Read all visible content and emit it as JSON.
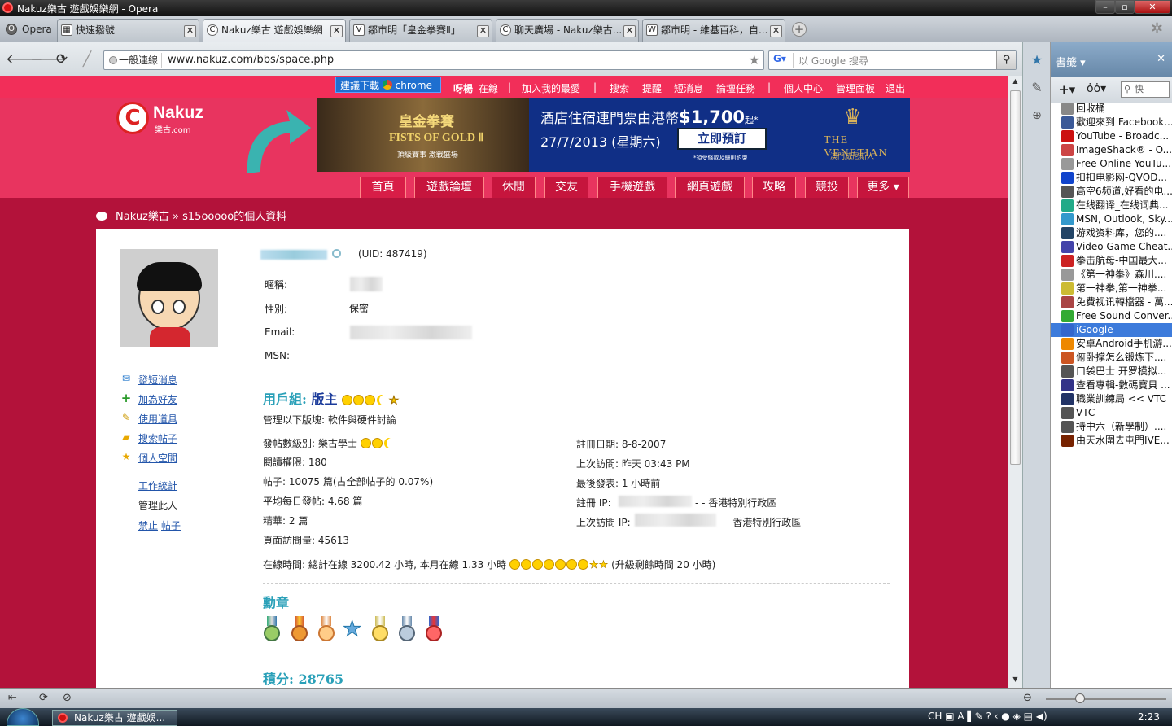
{
  "window": {
    "title": "Nakuz樂古 遊戲娛樂網 - Opera"
  },
  "browser": {
    "opera_label": "Opera",
    "tabs": [
      {
        "label": "快速撥號"
      },
      {
        "label": "Nakuz樂古 遊戲娛樂網"
      },
      {
        "label": "鄒市明「皇金拳賽Ⅱ」"
      },
      {
        "label": "聊天廣場 - Nakuz樂古..."
      },
      {
        "label": "鄒市明 - 維基百科，自..."
      }
    ],
    "security_label": "一般連線",
    "url": "www.nakuz.com/bbs/space.php",
    "search_placeholder": "以 Google 搜尋"
  },
  "site": {
    "download_label": "建議下載",
    "chrome_label": "chrome",
    "greeting_user": "呀楊",
    "online_label": "在線",
    "sep": "|",
    "links": [
      "加入我的最愛",
      "搜索",
      "提醒",
      "短消息",
      "論壇任務",
      "個人中心",
      "管理面板",
      "退出"
    ],
    "logo": {
      "name": "Nakuz",
      "domain": "樂古.com"
    },
    "banner": {
      "gold_title": "皇金拳賽",
      "fists": "FISTS OF GOLD Ⅱ",
      "sub": "頂級賽事 激戰盛場",
      "line1_prefix": "酒店住宿連門票由港幣",
      "price": "$1,700",
      "price_suffix": "起*",
      "date": "27/7/2013 (星期六)",
      "book_label": "立即預訂",
      "tnc": "*須受條款及細則約束",
      "brand": "THE VENETIAN",
      "brand_cn": "澳門威尼斯人"
    },
    "nav": [
      "首頁",
      "遊戲論壇",
      "休閒",
      "交友",
      "手機遊戲",
      "網頁遊戲",
      "攻略",
      "競投",
      "更多 ▾"
    ],
    "breadcrumb": {
      "home": "Nakuz樂古",
      "sep": "»",
      "current": "s15ooooo的個人資料"
    }
  },
  "profile": {
    "uid": "(UID: 487419)",
    "fields": [
      {
        "label": "暱稱:",
        "value": ""
      },
      {
        "label": "性別:",
        "value": "保密"
      },
      {
        "label": "Email:",
        "value": ""
      },
      {
        "label": "MSN:",
        "value": ""
      }
    ],
    "actions": [
      "發短消息",
      "加為好友",
      "使用道具",
      "搜索帖子",
      "個人空間"
    ],
    "admin": {
      "stats": "工作統計",
      "manage": "管理此人",
      "ban": "禁止",
      "posts": "帖子"
    },
    "group_label": "用戶組:",
    "group_value": "版主",
    "manage_forums_label": "管理以下版塊:",
    "manage_forums_value": "軟件與硬件討論",
    "left_stats": [
      "發帖數級別: 樂古學士",
      "閱讀權限: 180",
      "帖子: 10075 篇(占全部帖子的 0.07%)",
      "平均每日發帖: 4.68 篇",
      "精華: 2 篇",
      "頁面訪問量: 45613"
    ],
    "right_stats": [
      "註冊日期: 8-8-2007",
      "上次訪問: 昨天 03:43 PM",
      "最後發表: 1 小時前",
      "註冊 IP:",
      "上次訪問 IP:"
    ],
    "ip_region": "- - 香港特別行政區",
    "online_text": "在線時間: 總計在線 3200.42 小時, 本月在線 1.33 小時",
    "upgrade_text": "(升級剩餘時間 20 小時)",
    "medals_title": "勳章",
    "points_label": "積分:",
    "points_value": "28765"
  },
  "bookmarks": {
    "title": "書籤 ▾",
    "search_ph": "快",
    "items": [
      {
        "label": "回收桶",
        "icon": "trash-icon",
        "color": "#888"
      },
      {
        "label": "歡迎來到 Facebook...",
        "icon": "facebook-icon",
        "color": "#3b5998"
      },
      {
        "label": "YouTube - Broadc...",
        "icon": "youtube-icon",
        "color": "#cc1111"
      },
      {
        "label": "ImageShack® - O...",
        "icon": "imageshack-icon",
        "color": "#c44"
      },
      {
        "label": "Free Online YouTu...",
        "icon": "grid-icon",
        "color": "#999"
      },
      {
        "label": "扣扣电影网-QVOD...",
        "icon": "qvod-icon",
        "color": "#1144cc"
      },
      {
        "label": "高空6频道,好看的电...",
        "icon": "star-icon",
        "color": "#555"
      },
      {
        "label": "在线翻译_在线词典...",
        "icon": "dict-icon",
        "color": "#2a8"
      },
      {
        "label": "MSN, Outlook, Sky...",
        "icon": "msn-icon",
        "color": "#39c"
      },
      {
        "label": "游戏资料库，您的....",
        "icon": "tg-icon",
        "color": "#246"
      },
      {
        "label": "Video Game Cheat...",
        "icon": "cheat-icon",
        "color": "#44a"
      },
      {
        "label": "拳击航母-中国最大...",
        "icon": "boxing-icon",
        "color": "#c22"
      },
      {
        "label": "《第一神拳》森川....",
        "icon": "star-icon",
        "color": "#999"
      },
      {
        "label": "第一神拳,第一神拳...",
        "icon": "sf-icon",
        "color": "#cb3"
      },
      {
        "label": "免費视讯轉檔器 - 萬...",
        "icon": "convert-icon",
        "color": "#a44"
      },
      {
        "label": "Free Sound Conver...",
        "icon": "sound-icon",
        "color": "#3a3"
      },
      {
        "label": "iGoogle",
        "icon": "igoogle-icon",
        "color": "#36c"
      },
      {
        "label": "安卓Android手机游...",
        "icon": "android-icon",
        "color": "#e80"
      },
      {
        "label": "俯卧撑怎么锻炼下....",
        "icon": "baidu-icon",
        "color": "#c52"
      },
      {
        "label": "口袋巴士 开罗模拟...",
        "icon": "star-icon",
        "color": "#555"
      },
      {
        "label": "查看專輯-數碼寶貝 ...",
        "icon": "e-icon",
        "color": "#338"
      },
      {
        "label": "職業訓練局 << VTC",
        "icon": "vtc-icon",
        "color": "#236"
      },
      {
        "label": "VTC",
        "icon": "star-icon",
        "color": "#555"
      },
      {
        "label": "持中六（新學制）....",
        "icon": "star-icon",
        "color": "#555"
      },
      {
        "label": "由天水圍去屯門IVE...",
        "icon": "yahoo-icon",
        "color": "#720"
      }
    ]
  },
  "taskbar": {
    "task": "Nakuz樂古 遊戲娛...",
    "lang": "CH",
    "time": "2:23"
  }
}
